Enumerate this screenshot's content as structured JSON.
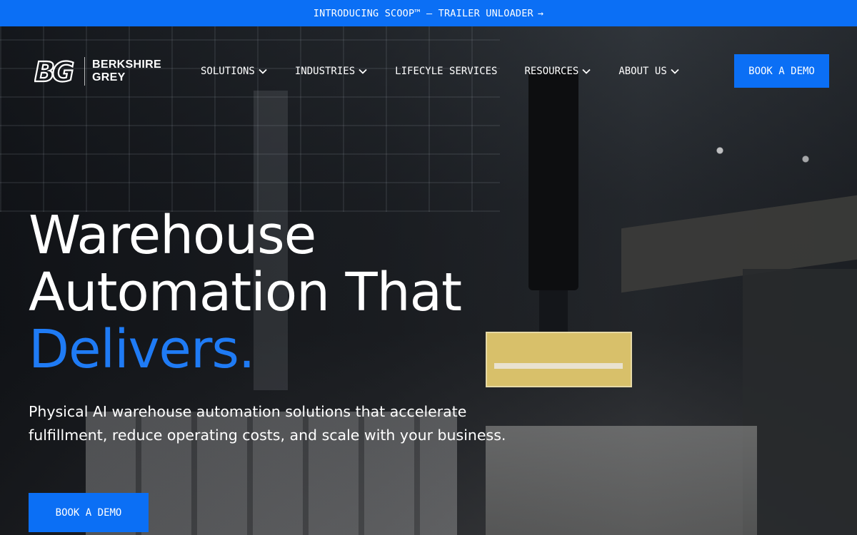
{
  "announcement": {
    "text": "INTRODUCING SCOOP™ — TRAILER UNLOADER",
    "arrow": "→"
  },
  "brand": {
    "line1": "BERKSHIRE",
    "line2": "GREY",
    "mark": "BG"
  },
  "nav": {
    "items": [
      {
        "label": "SOLUTIONS",
        "has_dropdown": true
      },
      {
        "label": "INDUSTRIES",
        "has_dropdown": true
      },
      {
        "label": "LIFECYLE SERVICES",
        "has_dropdown": false
      },
      {
        "label": "RESOURCES",
        "has_dropdown": true
      },
      {
        "label": "ABOUT US",
        "has_dropdown": true
      }
    ],
    "cta": "BOOK A DEMO"
  },
  "hero": {
    "headline_line1": "Warehouse",
    "headline_line2": "Automation That",
    "headline_accent": "Delivers.",
    "subtext": "Physical AI warehouse automation solutions that accelerate fulfillment, reduce operating costs, and scale with your business.",
    "cta": "BOOK A DEMO"
  },
  "colors": {
    "accent": "#0b6ff5",
    "headline_accent": "#1f7bf5",
    "text": "#ffffff"
  }
}
